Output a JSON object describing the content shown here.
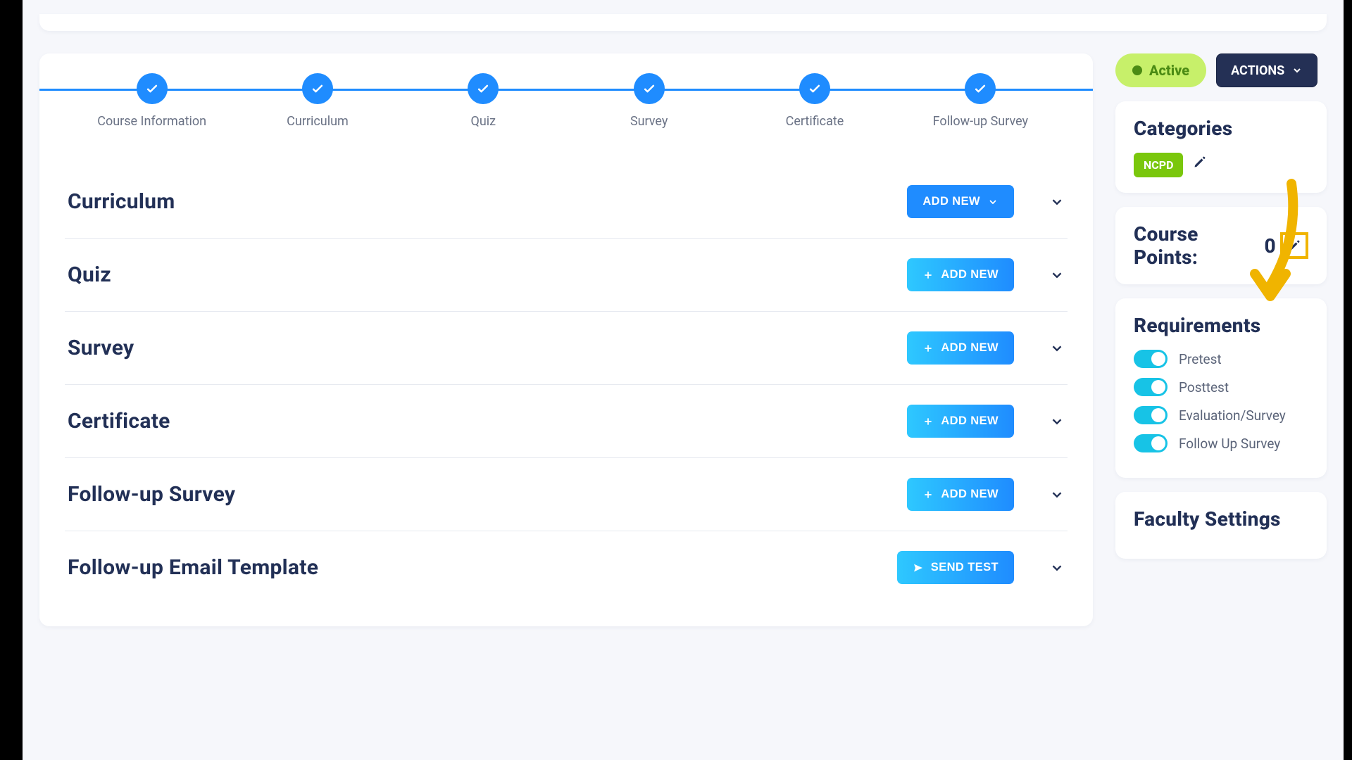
{
  "steps": [
    {
      "label": "Course Information"
    },
    {
      "label": "Curriculum"
    },
    {
      "label": "Quiz"
    },
    {
      "label": "Survey"
    },
    {
      "label": "Certificate"
    },
    {
      "label": "Follow-up Survey"
    }
  ],
  "sections": [
    {
      "title": "Curriculum",
      "button": "ADD NEW",
      "variant": "flat",
      "icon": "chevron"
    },
    {
      "title": "Quiz",
      "button": "ADD NEW",
      "variant": "grad",
      "icon": "plus"
    },
    {
      "title": "Survey",
      "button": "ADD NEW",
      "variant": "grad",
      "icon": "plus"
    },
    {
      "title": "Certificate",
      "button": "ADD NEW",
      "variant": "grad",
      "icon": "plus"
    },
    {
      "title": "Follow-up Survey",
      "button": "ADD NEW",
      "variant": "grad",
      "icon": "plus"
    },
    {
      "title": "Follow-up Email Template",
      "button": "SEND TEST",
      "variant": "grad",
      "icon": "send"
    }
  ],
  "status_label": "Active",
  "actions_label": "ACTIONS",
  "categories_title": "Categories",
  "categories": [
    "NCPD"
  ],
  "course_points_label": "Course Points:",
  "course_points_value": "0",
  "requirements_title": "Requirements",
  "requirements": [
    {
      "label": "Pretest",
      "on": true
    },
    {
      "label": "Posttest",
      "on": true
    },
    {
      "label": "Evaluation/Survey",
      "on": true
    },
    {
      "label": "Follow Up Survey",
      "on": true
    }
  ],
  "faculty_title": "Faculty Settings"
}
